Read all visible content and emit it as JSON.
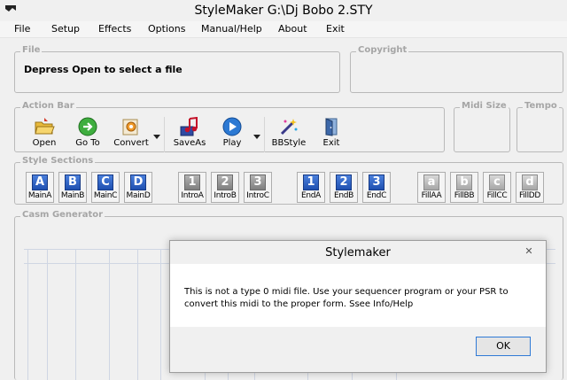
{
  "window": {
    "title": "StyleMaker   G:\\Dj Bobo 2.STY"
  },
  "menu": [
    "File",
    "Setup",
    "Effects",
    "Options",
    "Manual/Help",
    "About",
    "Exit"
  ],
  "file_group": {
    "label": "File",
    "message": "Depress Open to select a file"
  },
  "copyright_group": {
    "label": "Copyright"
  },
  "action_bar": {
    "label": "Action Bar",
    "buttons": [
      "Open",
      "Go To",
      "Convert",
      "SaveAs",
      "Play",
      "BBStyle",
      "Exit"
    ]
  },
  "midi_size": {
    "label": "Midi Size"
  },
  "tempo": {
    "label": "Tempo"
  },
  "style_sections": {
    "label": "Style Sections",
    "buttons": [
      {
        "glyph": "A",
        "label": "MainA"
      },
      {
        "glyph": "B",
        "label": "MainB"
      },
      {
        "glyph": "C",
        "label": "MainC"
      },
      {
        "glyph": "D",
        "label": "MainD"
      },
      {
        "glyph": "1",
        "label": "IntroA"
      },
      {
        "glyph": "2",
        "label": "IntroB"
      },
      {
        "glyph": "3",
        "label": "IntroC"
      },
      {
        "glyph": "1",
        "label": "EndA"
      },
      {
        "glyph": "2",
        "label": "EndB"
      },
      {
        "glyph": "3",
        "label": "EndC"
      },
      {
        "glyph": "a",
        "label": "FillAA"
      },
      {
        "glyph": "b",
        "label": "FillBB"
      },
      {
        "glyph": "c",
        "label": "FillCC"
      },
      {
        "glyph": "d",
        "label": "FillDD"
      }
    ]
  },
  "casm_generator": {
    "label": "Casm Generator"
  },
  "dialog": {
    "title": "Stylemaker",
    "close": "✕",
    "message": "This is not a type 0 midi file. Use your sequencer program or your PSR to convert this midi to the proper form. Ssee Info/Help",
    "ok": "OK"
  }
}
